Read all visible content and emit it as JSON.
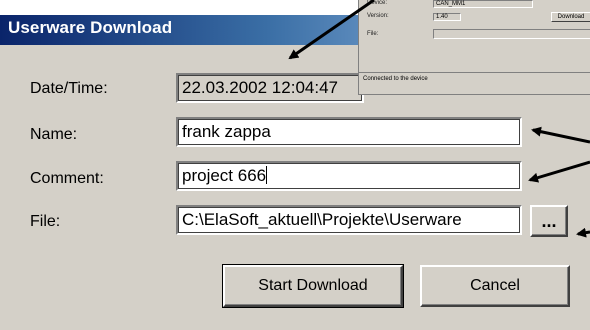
{
  "dialog": {
    "title": "Userware Download",
    "fields": {
      "datetime": {
        "label": "Date/Time:",
        "value": "22.03.2002 12:04:47"
      },
      "name": {
        "label": "Name:",
        "value": "frank zappa"
      },
      "comment": {
        "label": "Comment:",
        "value": "project 666"
      },
      "file": {
        "label": "File:",
        "value": "C:\\ElaSoft_aktuell\\Projekte\\Userware"
      }
    },
    "browse_label": "...",
    "start_label": "Start Download",
    "cancel_label": "Cancel"
  },
  "inset": {
    "device_label": "Device:",
    "device_value": "CAN_MM1",
    "version_label": "Version:",
    "version_value": "1.40",
    "file_label": "File:",
    "download_label": "Download",
    "status": "Connected to the device"
  },
  "colors": {
    "title_start": "#0a246a",
    "title_end": "#a6caf0",
    "face": "#d4d0c8"
  }
}
